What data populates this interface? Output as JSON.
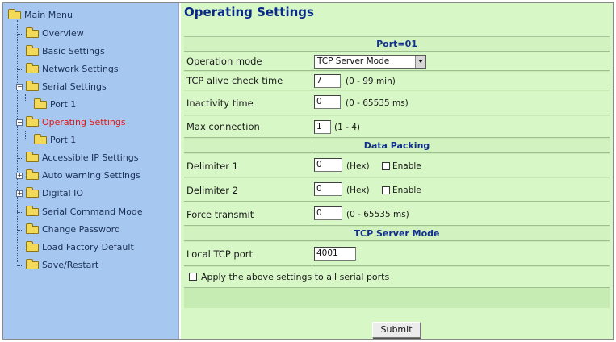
{
  "sidebar": {
    "root": "Main Menu",
    "items": [
      {
        "label": "Overview"
      },
      {
        "label": "Basic Settings"
      },
      {
        "label": "Network Settings"
      },
      {
        "label": "Serial Settings"
      },
      {
        "label": "Port 1"
      },
      {
        "label": "Operating Settings"
      },
      {
        "label": "Port 1"
      },
      {
        "label": "Accessible IP Settings"
      },
      {
        "label": "Auto warning Settings"
      },
      {
        "label": "Digital IO"
      },
      {
        "label": "Serial Command Mode"
      },
      {
        "label": "Change Password"
      },
      {
        "label": "Load Factory Default"
      },
      {
        "label": "Save/Restart"
      }
    ]
  },
  "main": {
    "title": "Operating Settings",
    "port_header": "Port=01",
    "operation_mode": {
      "label": "Operation mode",
      "value": "TCP Server Mode"
    },
    "alive_check": {
      "label": "TCP alive check time",
      "value": "7",
      "hint": "(0 - 99 min)"
    },
    "inactivity": {
      "label": "Inactivity time",
      "value": "0",
      "hint": "(0 - 65535 ms)"
    },
    "max_connection": {
      "label": "Max connection",
      "value": "1",
      "hint": "(1 - 4)"
    },
    "data_packing_header": "Data Packing",
    "delimiter1": {
      "label": "Delimiter 1",
      "value": "0",
      "unit": "(Hex)",
      "enable_label": "Enable"
    },
    "delimiter2": {
      "label": "Delimiter 2",
      "value": "0",
      "unit": "(Hex)",
      "enable_label": "Enable"
    },
    "force_transmit": {
      "label": "Force transmit",
      "value": "0",
      "hint": "(0 - 65535 ms)"
    },
    "tcp_server_header": "TCP Server Mode",
    "local_tcp_port": {
      "label": "Local TCP port",
      "value": "4001"
    },
    "apply_all_label": "Apply the above settings to all serial ports",
    "submit_label": "Submit"
  },
  "colors": {
    "sidebar_bg": "#a6c8f0",
    "content_bg": "#d8f7c7",
    "title": "#0a2a8a",
    "active_item": "#e01818"
  }
}
